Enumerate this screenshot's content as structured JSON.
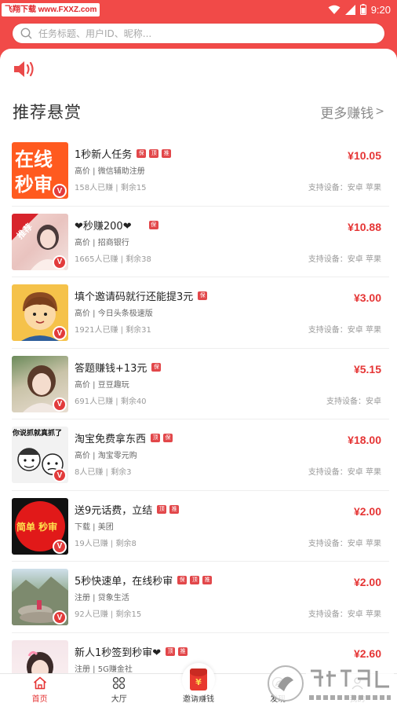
{
  "status": {
    "watermark_tag": "飞翔下载 www.FXXZ.com",
    "time": "9:20"
  },
  "search": {
    "placeholder": "任务标题、用户ID、昵称..."
  },
  "section": {
    "title": "推荐悬赏",
    "more": "更多赚钱",
    "more_chevron": ">"
  },
  "tasks": [
    {
      "title": "1秒新人任务",
      "tags": [
        "保",
        "顶",
        "推"
      ],
      "sub": "高价 | 微信辅助注册",
      "stat": "158人已赚 | 剩余15",
      "price": "¥10.05",
      "device": "支持设备：安卓 苹果",
      "thumb_text": "在线秒审"
    },
    {
      "title": "❤秒赚200❤",
      "tags": [
        "保"
      ],
      "sub": "高价 | 招商银行",
      "stat": "1665人已赚 | 剩余38",
      "price": "¥10.88",
      "device": "支持设备：安卓 苹果",
      "thumb_text": "推荐"
    },
    {
      "title": "填个邀请码就行还能提3元",
      "tags": [
        "保"
      ],
      "sub": "高价 | 今日头条极速版",
      "stat": "1921人已赚 | 剩余31",
      "price": "¥3.00",
      "device": "支持设备：安卓 苹果",
      "thumb_text": ""
    },
    {
      "title": "答题赚钱+13元",
      "tags": [
        "保"
      ],
      "sub": "高价 | 豆豆趣玩",
      "stat": "691人已赚 | 剩余40",
      "price": "¥5.15",
      "device": "支持设备：安卓",
      "thumb_text": ""
    },
    {
      "title": "淘宝免费拿东西",
      "tags": [
        "顶",
        "保"
      ],
      "sub": "高价 | 淘宝零元购",
      "stat": "8人已赚 | 剩余3",
      "price": "¥18.00",
      "device": "支持设备：安卓 苹果",
      "thumb_text": "你说抓就真抓了"
    },
    {
      "title": "送9元话费，立结",
      "tags": [
        "顶",
        "推"
      ],
      "sub": "下载 | 美团",
      "stat": "19人已赚 | 剩余8",
      "price": "¥2.00",
      "device": "支持设备：安卓 苹果",
      "thumb_text": "简单 秒审"
    },
    {
      "title": "5秒快速单，在线秒审",
      "tags": [
        "保",
        "顶",
        "推"
      ],
      "sub": "注册 | 贷象生活",
      "stat": "92人已赚 | 剩余15",
      "price": "¥2.00",
      "device": "支持设备：安卓 苹果",
      "thumb_text": ""
    },
    {
      "title": "新人1秒签到秒审❤",
      "tags": [
        "顶",
        "推"
      ],
      "sub": "注册 | 5G赚金社",
      "stat": "",
      "price": "¥2.60",
      "device": "",
      "thumb_text": ""
    }
  ],
  "tabbar": {
    "home": "首页",
    "hall": "大厅",
    "invite": "邀请赚钱",
    "discover": "发现",
    "mine": "我的",
    "invite_symbol": "¥"
  },
  "colors": {
    "brand": "#f14a48",
    "price": "#e53535"
  }
}
